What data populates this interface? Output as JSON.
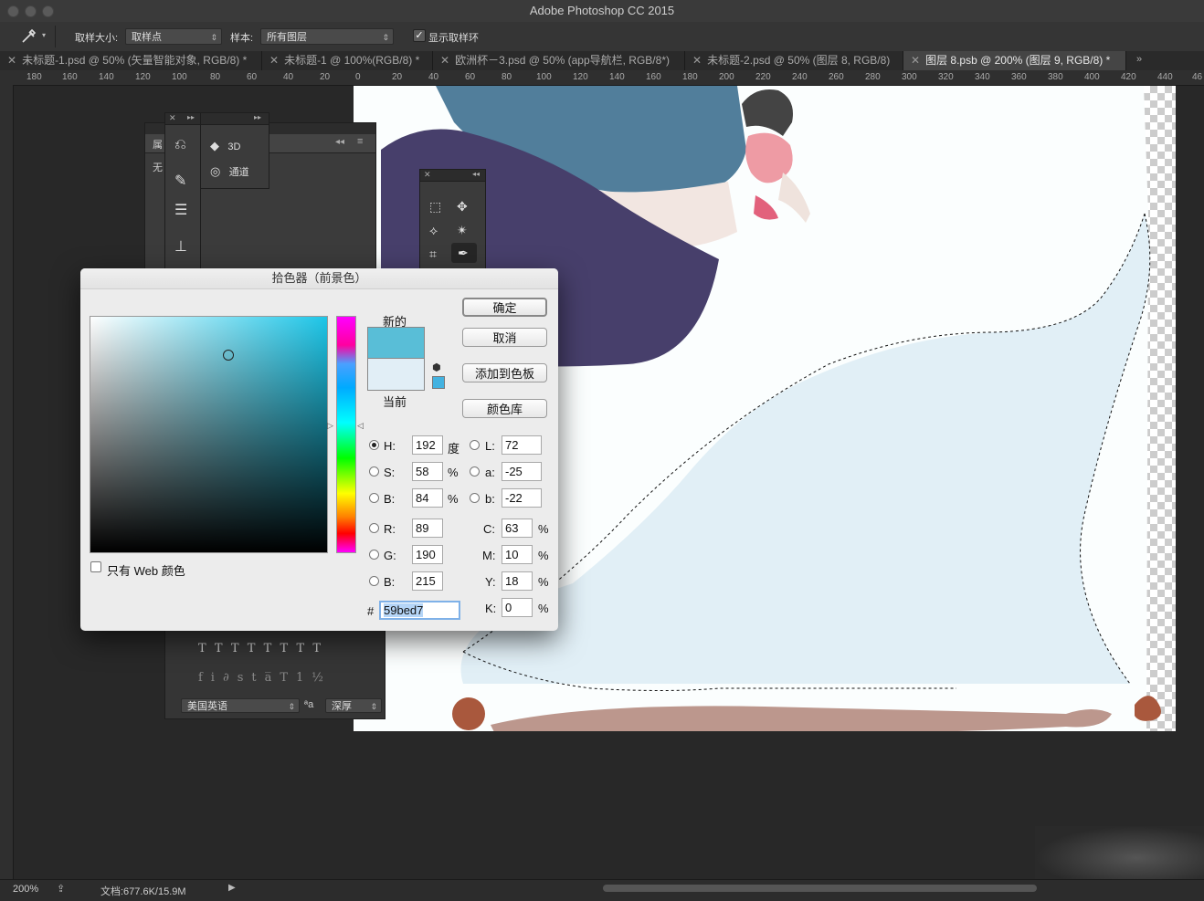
{
  "app": {
    "title": "Adobe Photoshop CC 2015"
  },
  "options": {
    "sample_size_label": "取样大小:",
    "sample_size_value": "取样点",
    "sample_label": "样本:",
    "sample_value": "所有图层",
    "show_ring_label": "显示取样环"
  },
  "tabs": [
    {
      "label": "未标题-1.psd @ 50% (矢量智能对象, RGB/8) *"
    },
    {
      "label": "未标题-1 @ 100%(RGB/8) *"
    },
    {
      "label": "欧洲杯－3.psd @ 50% (app导航栏, RGB/8*)"
    },
    {
      "label": "未标题-2.psd @ 50% (图层 8, RGB/8)"
    },
    {
      "label": "图层 8.psb @ 200% (图层 9, RGB/8) *"
    }
  ],
  "ruler": {
    "h": [
      "180",
      "160",
      "140",
      "120",
      "100",
      "80",
      "60",
      "40",
      "20",
      "0",
      "20",
      "40",
      "60",
      "80",
      "100",
      "120",
      "140",
      "160",
      "180",
      "200",
      "220",
      "240",
      "260",
      "280",
      "300",
      "320",
      "340",
      "360",
      "380",
      "400",
      "420",
      "440",
      "46"
    ]
  },
  "panels": {
    "item_3d": "3D",
    "item_channels": "通道",
    "props_short": "属",
    "none_short": "无",
    "lang": "美国英语",
    "aa": "深厚",
    "aa_icon": "ªa"
  },
  "dialog": {
    "title": "拾色器（前景色）",
    "new_label": "新的",
    "current_label": "当前",
    "ok": "确定",
    "cancel": "取消",
    "add_swatch": "添加到色板",
    "color_libs": "颜色库",
    "web_only": "只有 Web 颜色",
    "hex_hash": "#",
    "hex": "59bed7",
    "H": {
      "label": "H:",
      "value": "192",
      "unit": "度"
    },
    "S": {
      "label": "S:",
      "value": "58",
      "unit": "%"
    },
    "Bv": {
      "label": "B:",
      "value": "84",
      "unit": "%"
    },
    "R": {
      "label": "R:",
      "value": "89"
    },
    "G": {
      "label": "G:",
      "value": "190"
    },
    "Bc": {
      "label": "B:",
      "value": "215"
    },
    "L": {
      "label": "L:",
      "value": "72"
    },
    "a": {
      "label": "a:",
      "value": "-25"
    },
    "b": {
      "label": "b:",
      "value": "-22"
    },
    "C": {
      "label": "C:",
      "value": "63",
      "unit": "%"
    },
    "M": {
      "label": "M:",
      "value": "10",
      "unit": "%"
    },
    "Y": {
      "label": "Y:",
      "value": "18",
      "unit": "%"
    },
    "K": {
      "label": "K:",
      "value": "0",
      "unit": "%"
    },
    "new_color": "#59bed7",
    "current_color": "#e1eef6"
  },
  "status": {
    "zoom": "200%",
    "doc": "文档:677.6K/15.9M"
  }
}
